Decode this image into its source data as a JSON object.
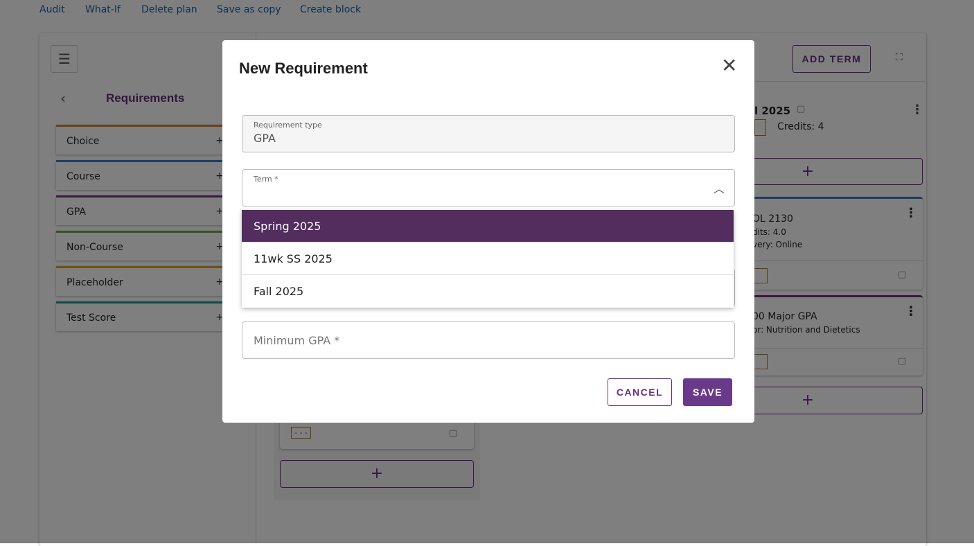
{
  "toolbar": {
    "links": [
      "Audit",
      "What-If",
      "Delete plan",
      "Save as copy",
      "Create block"
    ]
  },
  "sidebar": {
    "title": "Requirements",
    "items": [
      {
        "label": "Choice",
        "color": "#d9822b"
      },
      {
        "label": "Course",
        "color": "#3d7cc9"
      },
      {
        "label": "GPA",
        "color": "#7b2d82"
      },
      {
        "label": "Non-Course",
        "color": "#6aae3f"
      },
      {
        "label": "Placeholder",
        "color": "#d9a72b"
      },
      {
        "label": "Test Score",
        "color": "#1b9c85"
      }
    ]
  },
  "plan": {
    "add_term_label": "ADD TERM",
    "term_title": "l 2025",
    "credits_label": "Credits:",
    "credits_value": "4",
    "badge": "- - -",
    "card1": {
      "title": "OL 2130",
      "credits": "dits: 4.0",
      "delivery": "very: Online"
    },
    "card2": {
      "title": "00 Major GPA",
      "subtitle": "or: Nutrition and Dietetics"
    }
  },
  "modal": {
    "title": "New Requirement",
    "requirement_type": {
      "label": "Requirement type",
      "value": "GPA"
    },
    "term": {
      "label": "Term *",
      "value": ""
    },
    "term_options": [
      "Spring 2025",
      "11wk SS 2025",
      "Fall 2025"
    ],
    "min_gpa": {
      "placeholder": "Minimum GPA *"
    },
    "cancel_label": "CANCEL",
    "save_label": "SAVE"
  },
  "colors": {
    "accent": "#6a3a8a",
    "selected_option": "#522d5e"
  }
}
